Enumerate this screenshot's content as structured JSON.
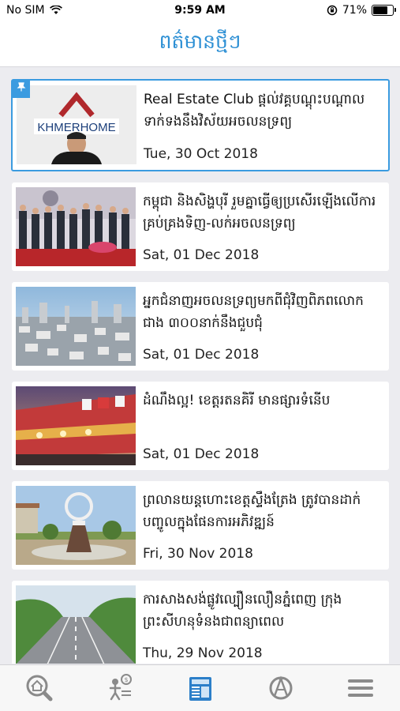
{
  "status_bar": {
    "carrier": "No SIM",
    "time": "9:59 AM",
    "battery": "71%"
  },
  "header": {
    "title": "ពត៌មានថ្មីៗ"
  },
  "articles": [
    {
      "title": "Real Estate Club ផ្តល់វគ្គបណ្តុះបណ្តាលទាក់ទងនឹងវិស័យអចលនទ្រព្យ",
      "date": "Tue, 30 Oct 2018",
      "pinned": true,
      "logo_text": "KHMERHOME"
    },
    {
      "title": "កម្ពុជា និងសិង្ហបុរី រួមគ្នាធ្វើឲ្យប្រសើរឡើងលើការគ្រប់គ្រងទិញ-លក់អចលនទ្រព្យ",
      "date": "Sat, 01 Dec 2018"
    },
    {
      "title": "អ្នកជំនាញអចលនទ្រព្យមកពីជុំវិញពិភពលោកជាង ៣០០នាក់នឹងជួបជុំ",
      "date": "Sat, 01 Dec 2018"
    },
    {
      "title": "ដំណឹងល្អ! ខេត្តរតនគិរី មានផ្សារទំនើប",
      "date": "Sat, 01 Dec 2018"
    },
    {
      "title": "ព្រលានយន្តហោះខេត្តស្ទឹងត្រែង ត្រូវបានដាក់បញ្ចូលក្នុងផែនការអភិវឌ្ឍន៍",
      "date": "Fri, 30 Nov 2018"
    },
    {
      "title": "ការសាងសង់ផ្លូវល្បឿនលឿនភ្នំពេញ ក្រុងព្រះសីហនុទំនងជាពន្យាពេល",
      "date": "Thu, 29 Nov 2018"
    }
  ],
  "tabs": [
    "search-home-icon",
    "money-person-icon",
    "news-icon",
    "tools-icon",
    "menu-icon"
  ],
  "colors": {
    "accent": "#2c8fd4"
  }
}
